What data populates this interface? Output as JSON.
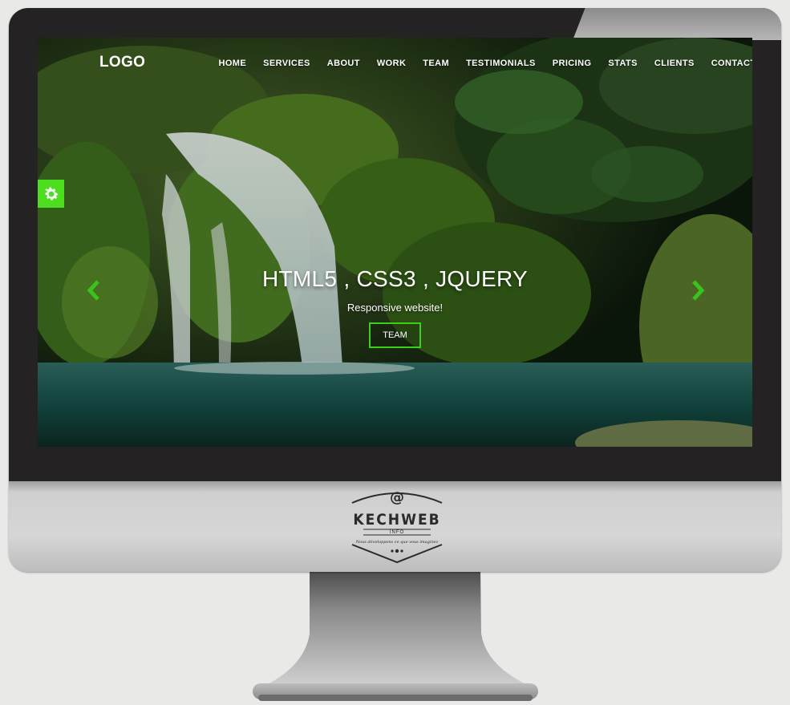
{
  "site": {
    "logo": "LOGO",
    "nav": [
      "HOME",
      "SERVICES",
      "ABOUT",
      "WORK",
      "TEAM",
      "TESTIMONIALS",
      "PRICING",
      "STATS",
      "CLIENTS",
      "CONTACT"
    ],
    "hero": {
      "title": "HTML5 , CSS3 , JQUERY",
      "subtitle": "Responsive website!",
      "button": "TEAM"
    },
    "accent_color": "#4cde1f"
  },
  "brand": {
    "symbol": "@",
    "name": "KECHWEB",
    "sub": "INFO",
    "tagline": "Nous développons ce que vous imaginez"
  },
  "icons": {
    "settings": "gear-icon",
    "prev": "chevron-left-icon",
    "next": "chevron-right-icon"
  }
}
